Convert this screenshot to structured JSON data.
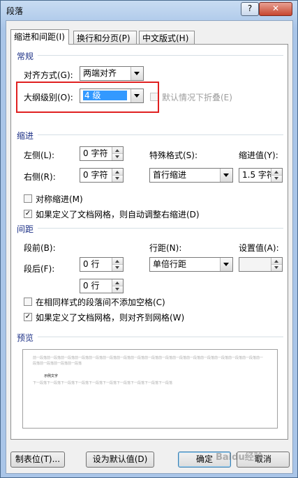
{
  "window": {
    "title": "段落",
    "help": "?",
    "close": "✕"
  },
  "tabs": [
    {
      "label": "缩进和间距(I)",
      "active": true
    },
    {
      "label": "换行和分页(P)",
      "active": false
    },
    {
      "label": "中文版式(H)",
      "active": false
    }
  ],
  "general": {
    "section": "常规",
    "alignment_label": "对齐方式(G):",
    "alignment_value": "两端对齐",
    "outline_label": "大纲级别(O):",
    "outline_value": "4 级",
    "collapse_label": "默认情况下折叠(E)"
  },
  "indent": {
    "section": "缩进",
    "left_label": "左侧(L):",
    "left_value": "0 字符",
    "right_label": "右侧(R):",
    "right_value": "0 字符",
    "special_label": "特殊格式(S):",
    "special_value": "首行缩进",
    "by_label": "缩进值(Y):",
    "by_value": "1.5 字符",
    "mirror_label": "对称缩进(M)",
    "mirror_checked": false,
    "auto_adjust_label": "如果定义了文档网格，则自动调整右缩进(D)",
    "auto_adjust_checked": true
  },
  "spacing": {
    "section": "间距",
    "before_label": "段前(B):",
    "before_value": "0 行",
    "after_label": "段后(F):",
    "after_value": "0 行",
    "line_label": "行距(N):",
    "line_value": "单倍行距",
    "at_label": "设置值(A):",
    "at_value": "",
    "no_space_label": "在相同样式的段落间不添加空格(C)",
    "no_space_checked": false,
    "snap_grid_label": "如果定义了文档网格，则对齐到网格(W)",
    "snap_grid_checked": true
  },
  "preview": {
    "section": "预览",
    "prev_text": "前一段落前一段落前一段落前一段落前一段落前一段落前一段落前一段落前一段落前一段落前一段落前一段落前一段落前一段落前一段落前一段落前一段落前一段落前一段落前一段落",
    "sample_text": "示例文字",
    "next_text": "下一段落下一段落下一段落下一段落下一段落下一段落下一段落下一段落下一段落下一段落"
  },
  "buttons": {
    "tabs": "制表位(T)...",
    "set_default": "设为默认值(D)",
    "ok": "确定",
    "cancel": "取消"
  },
  "watermark": "Baidu经验"
}
